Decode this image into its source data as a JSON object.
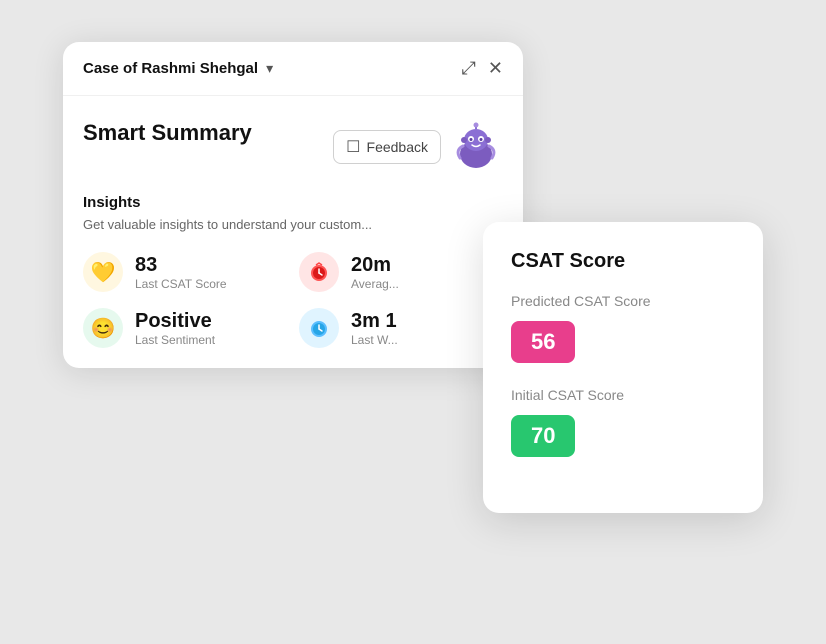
{
  "header": {
    "title": "Case of Rashmi Shehgal",
    "chevron": "▾",
    "expand_icon": "⤢",
    "close_icon": "✕"
  },
  "smart_summary": {
    "title": "Smart Summary",
    "feedback_label": "Feedback",
    "insights_label": "Insights",
    "insights_desc": "Get valuable insights to understand your custom..."
  },
  "metrics": [
    {
      "value": "83",
      "label": "Last CSAT Score",
      "icon_type": "yellow",
      "icon": "🤍"
    },
    {
      "value": "20m",
      "label": "Average",
      "icon_type": "red",
      "icon": "⏱"
    },
    {
      "value": "Positive",
      "label": "Last Sentiment",
      "icon_type": "green",
      "icon": "😊"
    },
    {
      "value": "3m 1",
      "label": "Last W...",
      "icon_type": "blue",
      "icon": "⏰"
    }
  ],
  "csat_card": {
    "title": "CSAT Score",
    "predicted_label": "Predicted CSAT Score",
    "predicted_value": "56",
    "initial_label": "Initial CSAT Score",
    "initial_value": "70"
  }
}
